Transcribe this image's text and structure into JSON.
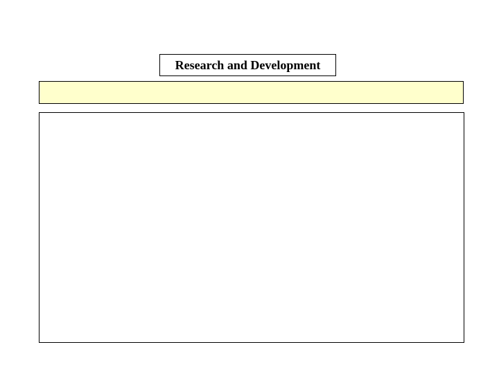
{
  "slide": {
    "title": "Research and Development",
    "banner_text": "",
    "content_text": ""
  },
  "colors": {
    "banner_fill": "#ffffcc",
    "border": "#000000",
    "background": "#ffffff"
  }
}
